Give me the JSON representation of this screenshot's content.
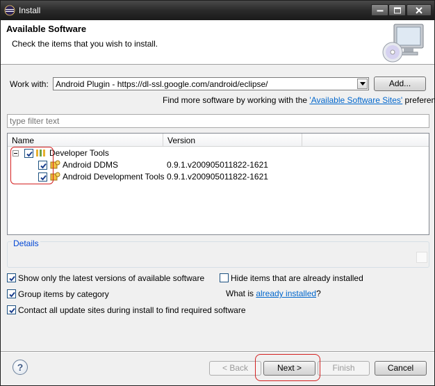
{
  "window": {
    "title": "Install",
    "icons": {
      "app": "eclipse-icon",
      "minimize": "minimize-icon",
      "maximize": "maximize-icon",
      "close": "close-icon"
    }
  },
  "header": {
    "title": "Available Software",
    "description": "Check the items that you wish to install.",
    "image": "monitor-cd-icon"
  },
  "work_with": {
    "label": "Work with:",
    "value": "Android Plugin - https://dl-ssl.google.com/android/eclipse/",
    "add_button": "Add..."
  },
  "find_more": {
    "prefix": "Find more software by working with the ",
    "link": "'Available Software Sites'",
    "suffix": " preferences."
  },
  "filter": {
    "placeholder": "type filter text"
  },
  "table": {
    "columns": [
      "Name",
      "Version"
    ],
    "rows": [
      {
        "name": "Developer Tools",
        "version": "",
        "checked": true,
        "level": 0,
        "expanded": true
      },
      {
        "name": "Android DDMS",
        "version": "0.9.1.v200905011822-1621",
        "checked": true,
        "level": 1
      },
      {
        "name": "Android Development Tools",
        "version": "0.9.1.v200905011822-1621",
        "checked": true,
        "level": 1
      }
    ]
  },
  "details": {
    "legend": "Details"
  },
  "options": {
    "show_latest": {
      "label": "Show only the latest versions of available software",
      "checked": true
    },
    "group_by_category": {
      "label": "Group items by category",
      "checked": true
    },
    "contact_sites": {
      "label": "Contact all update sites during install to find required software",
      "checked": true
    },
    "hide_installed": {
      "label": "Hide items that are already installed",
      "checked": false
    },
    "what_is": {
      "prefix": "What is ",
      "link": "already installed",
      "suffix": "?"
    }
  },
  "buttons": {
    "help": "?",
    "back": "< Back",
    "next": "Next >",
    "finish": "Finish",
    "cancel": "Cancel"
  },
  "colors": {
    "link": "#0066cc",
    "highlight": "#d42020",
    "details_legend": "#0046d5"
  }
}
